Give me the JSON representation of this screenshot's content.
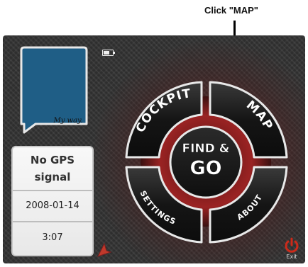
{
  "annotation": {
    "text": "Click \"MAP\""
  },
  "logo": {
    "text": "My way."
  },
  "status": {
    "gps_line1": "No GPS",
    "gps_line2": "signal",
    "date": "2008-01-14",
    "time": "3:07",
    "battery_level": 0.6
  },
  "menu": {
    "cockpit_label": "COCKPIT",
    "map_label": "MAP",
    "settings_label": "SETTINGS",
    "about_label": "ABOUT",
    "center_line1": "FIND &",
    "center_line2": "GO"
  },
  "exit": {
    "label": "Exit"
  },
  "colors": {
    "logo_blue": "#1f5e86",
    "button_dark": "#1c1c1c",
    "ring_red": "#8b1a1a",
    "exit_red": "#cc2a1a",
    "arrow_red": "#c0392b"
  },
  "icons": {
    "battery": "battery-icon",
    "nav_arrow": "navigation-arrow-icon",
    "exit": "power-icon"
  }
}
